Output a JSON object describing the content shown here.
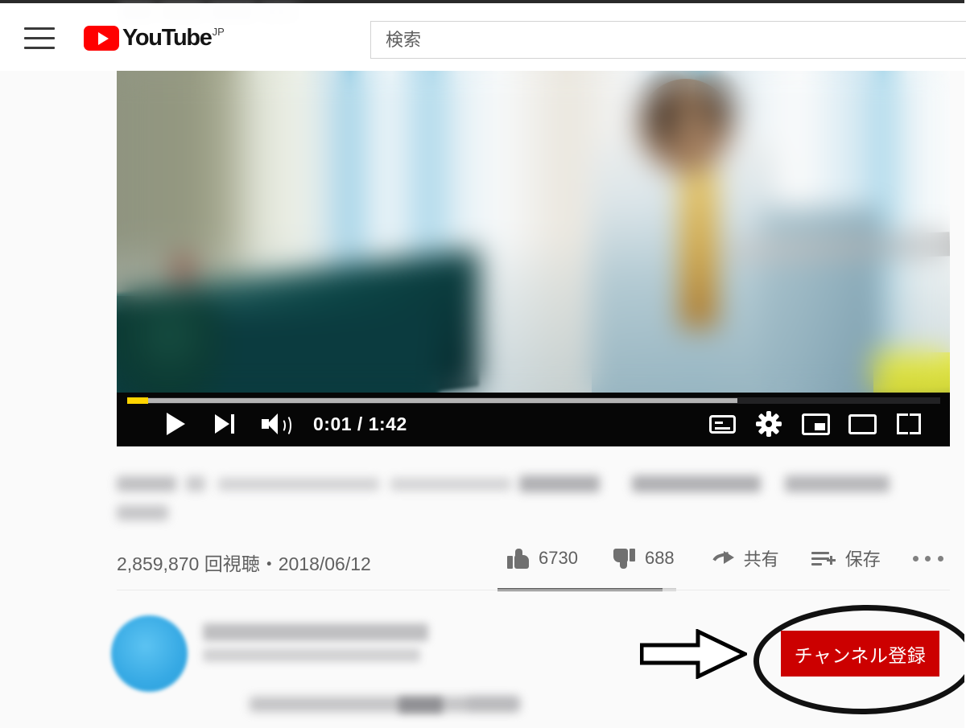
{
  "header": {
    "menu_icon": "hamburger-menu-icon",
    "logo_text": "YouTube",
    "logo_superscript": "JP",
    "logo_play_icon": "play-triangle-icon",
    "search": {
      "placeholder": "検索",
      "value": ""
    }
  },
  "player": {
    "progress": {
      "played_percent": 2.6,
      "buffered_percent": 75,
      "played_color": "#ffd400",
      "buffered_color": "#b4b4b4",
      "track_color": "#222224"
    },
    "controls_left": [
      {
        "name": "play-button",
        "icon": "play-icon"
      },
      {
        "name": "next-video-button",
        "icon": "next-track-icon"
      },
      {
        "name": "volume-button",
        "icon": "volume-high-icon"
      }
    ],
    "time_display": "0:01 / 1:42",
    "current_time": "0:01",
    "duration": "1:42",
    "controls_right": [
      {
        "name": "subtitles-button",
        "icon": "closed-captions-icon"
      },
      {
        "name": "settings-button",
        "icon": "gear-icon"
      },
      {
        "name": "miniplayer-button",
        "icon": "miniplayer-icon"
      },
      {
        "name": "theater-mode-button",
        "icon": "theater-mode-icon"
      },
      {
        "name": "fullscreen-button",
        "icon": "fullscreen-icon"
      }
    ]
  },
  "video": {
    "title_redacted": true,
    "views_and_date": "2,859,870 回視聴・2018/06/12",
    "view_count": "2,859,870",
    "views_label": "回視聴",
    "upload_date": "2018/06/12"
  },
  "actions": [
    {
      "name": "like-button",
      "icon": "thumbs-up-icon",
      "label": "6730"
    },
    {
      "name": "dislike-button",
      "icon": "thumbs-down-icon",
      "label": "688"
    },
    {
      "name": "share-button",
      "icon": "share-arrow-icon",
      "label": "共有"
    },
    {
      "name": "save-button",
      "icon": "save-playlist-icon",
      "label": "保存"
    },
    {
      "name": "more-actions-button",
      "icon": "more-horizontal-icon",
      "label": ""
    }
  ],
  "channel": {
    "avatar_color": "#36a9e4",
    "name_redacted": true,
    "subscriber_count_redacted": true,
    "subscribe_label": "チャンネル登録",
    "subscribe_color": "#cc0000"
  },
  "annotations": {
    "ellipse": {
      "name": "highlight-ellipse",
      "color": "#111111"
    },
    "arrow": {
      "name": "pointer-arrow",
      "fill": "#ffffff",
      "stroke": "#000000"
    }
  },
  "colors": {
    "page_background": "#fafafa",
    "brand_red": "#ff0000",
    "text_secondary": "#606060"
  }
}
